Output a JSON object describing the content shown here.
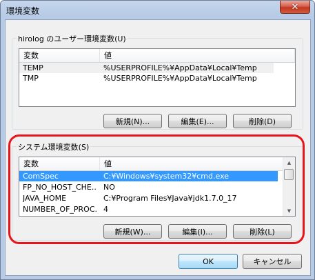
{
  "window": {
    "title": "環境変数",
    "close_symbol": "✕"
  },
  "user_vars": {
    "group_title": "hirolog のユーザー環境変数(U)",
    "columns": [
      "変数",
      "値"
    ],
    "rows": [
      {
        "name": "TEMP",
        "value": "%USERPROFILE%¥AppData¥Local¥Temp"
      },
      {
        "name": "TMP",
        "value": "%USERPROFILE%¥AppData¥Local¥Temp"
      }
    ],
    "buttons": {
      "new": "新規(N)...",
      "edit": "編集(E)...",
      "delete": "削除(D)"
    }
  },
  "system_vars": {
    "group_title": "システム環境変数(S)",
    "columns": [
      "変数",
      "値"
    ],
    "rows": [
      {
        "name": "ComSpec",
        "value": "C:¥Windows¥system32¥cmd.exe"
      },
      {
        "name": "FP_NO_HOST_CHE...",
        "value": "NO"
      },
      {
        "name": "JAVA_HOME",
        "value": "C:¥Program Files¥Java¥jdk1.7.0_17"
      },
      {
        "name": "NUMBER_OF_PROC...",
        "value": "4"
      }
    ],
    "buttons": {
      "new": "新規(W)...",
      "edit": "編集(I)...",
      "delete": "削除(L)"
    }
  },
  "footer": {
    "ok": "OK",
    "cancel": "キャンセル"
  },
  "colors": {
    "selection": "#3399ff",
    "highlight_outline": "#e8141c"
  }
}
